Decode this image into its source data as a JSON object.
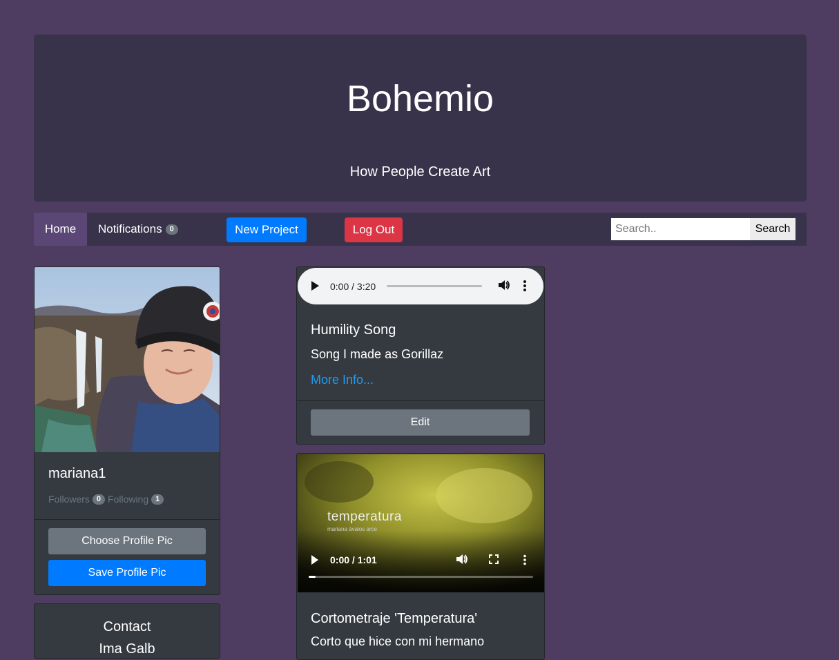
{
  "header": {
    "title": "Bohemio",
    "subtitle": "How People Create Art"
  },
  "nav": {
    "home": "Home",
    "notifications": "Notifications",
    "notifications_count": "0",
    "new_project": "New Project",
    "log_out": "Log Out",
    "search_placeholder": "Search..",
    "search_button": "Search"
  },
  "profile": {
    "username": "mariana1",
    "followers_label": "Followers",
    "followers_count": "0",
    "following_label": "Following",
    "following_count": "1",
    "choose_pic": "Choose Profile Pic",
    "save_pic": "Save Profile Pic"
  },
  "contact": {
    "title": "Contact",
    "subtitle": "Ima Galb"
  },
  "projects": [
    {
      "media": "audio",
      "time": "0:00 / 3:20",
      "title": "Humility Song",
      "description": "Song I made as Gorillaz",
      "link": "More Info...",
      "edit": "Edit"
    },
    {
      "media": "video",
      "time": "0:00 / 1:01",
      "overlay_title": "temperatura",
      "overlay_subtitle": "mariana ávalos arce",
      "progress": 0.03,
      "title": "Cortometraje 'Temperatura'",
      "description": "Corto que hice con mi hermano"
    }
  ],
  "colors": {
    "background": "#4e3d60",
    "panel": "#38334a",
    "card": "#343a40",
    "primary": "#007bff",
    "danger": "#dc3545",
    "secondary": "#6c757d",
    "link": "#1f9cf0"
  }
}
